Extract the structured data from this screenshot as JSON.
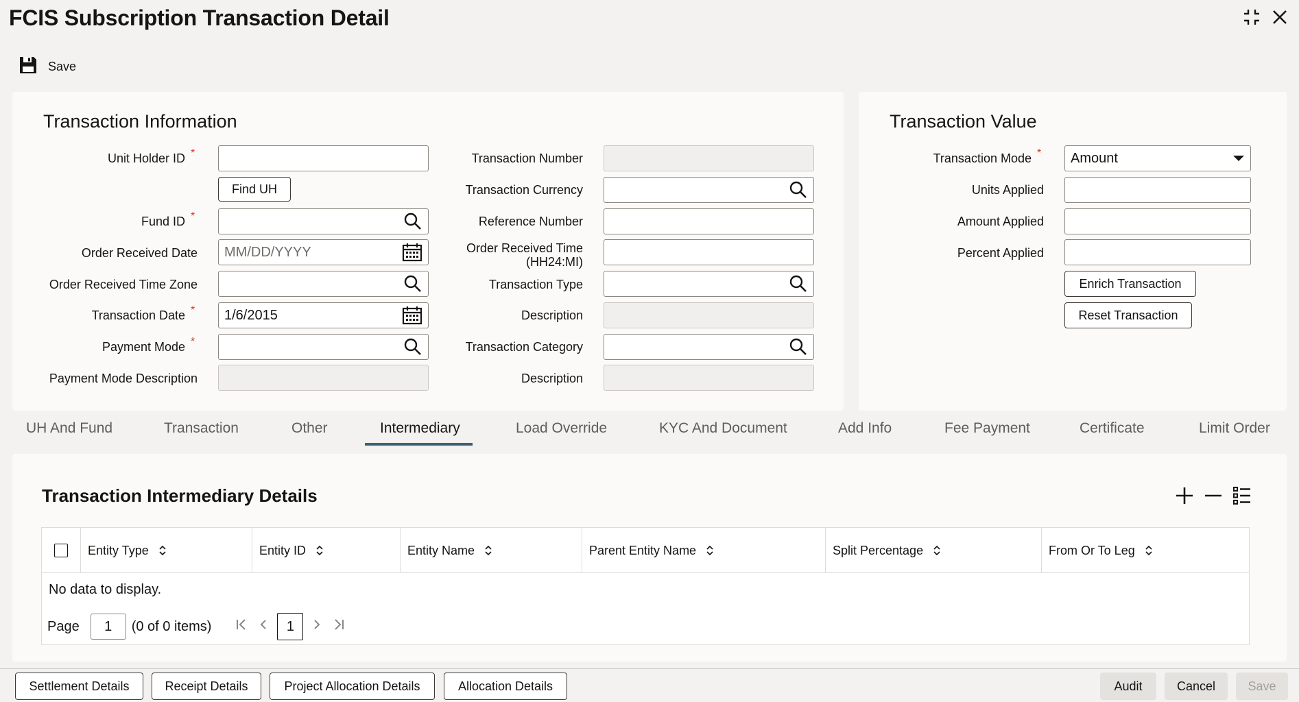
{
  "window": {
    "title": "FCIS Subscription Transaction Detail"
  },
  "toolbar": {
    "save_label": "Save"
  },
  "transaction_info": {
    "title": "Transaction Information",
    "unit_holder_id": {
      "label": "Unit Holder ID",
      "value": ""
    },
    "find_uh_label": "Find UH",
    "fund_id": {
      "label": "Fund ID",
      "value": ""
    },
    "order_received_date": {
      "label": "Order Received Date",
      "placeholder": "MM/DD/YYYY"
    },
    "order_received_time_zone": {
      "label": "Order Received Time Zone",
      "value": ""
    },
    "transaction_date": {
      "label": "Transaction Date",
      "value": "1/6/2015"
    },
    "payment_mode": {
      "label": "Payment Mode",
      "value": ""
    },
    "payment_mode_description": {
      "label": "Payment Mode Description",
      "value": ""
    },
    "transaction_number": {
      "label": "Transaction Number",
      "value": ""
    },
    "transaction_currency": {
      "label": "Transaction Currency",
      "value": ""
    },
    "reference_number": {
      "label": "Reference Number",
      "value": ""
    },
    "order_received_time": {
      "label_line1": "Order Received Time",
      "label_line2": "(HH24:MI)",
      "value": ""
    },
    "transaction_type": {
      "label": "Transaction Type",
      "value": ""
    },
    "description1": {
      "label": "Description",
      "value": ""
    },
    "transaction_category": {
      "label": "Transaction Category",
      "value": ""
    },
    "description2": {
      "label": "Description",
      "value": ""
    }
  },
  "transaction_value": {
    "title": "Transaction Value",
    "transaction_mode": {
      "label": "Transaction Mode",
      "value": "Amount"
    },
    "units_applied": {
      "label": "Units Applied",
      "value": ""
    },
    "amount_applied": {
      "label": "Amount Applied",
      "value": ""
    },
    "percent_applied": {
      "label": "Percent Applied",
      "value": ""
    },
    "enrich_label": "Enrich Transaction",
    "reset_label": "Reset Transaction"
  },
  "tabs": [
    {
      "label": "UH And Fund"
    },
    {
      "label": "Transaction"
    },
    {
      "label": "Other"
    },
    {
      "label": "Intermediary"
    },
    {
      "label": "Load Override"
    },
    {
      "label": "KYC And Document"
    },
    {
      "label": "Add Info"
    },
    {
      "label": "Fee Payment"
    },
    {
      "label": "Certificate"
    },
    {
      "label": "Limit Order"
    }
  ],
  "intermediary": {
    "title": "Transaction Intermediary Details",
    "columns": [
      "Entity Type",
      "Entity ID",
      "Entity Name",
      "Parent Entity Name",
      "Split Percentage",
      "From Or To Leg"
    ],
    "empty_text": "No data to display.",
    "pager": {
      "page_label": "Page",
      "page_value": "1",
      "items_text": "(0 of 0 items)",
      "current_page": "1"
    }
  },
  "footer": {
    "settlement_label": "Settlement Details",
    "receipt_label": "Receipt Details",
    "project_allocation_label": "Project Allocation Details",
    "allocation_label": "Allocation Details",
    "audit_label": "Audit",
    "cancel_label": "Cancel",
    "save_label": "Save"
  },
  "colors": {
    "required": "#d63b25",
    "tab_active": "#3b6173",
    "background": "#f3f2f0"
  }
}
